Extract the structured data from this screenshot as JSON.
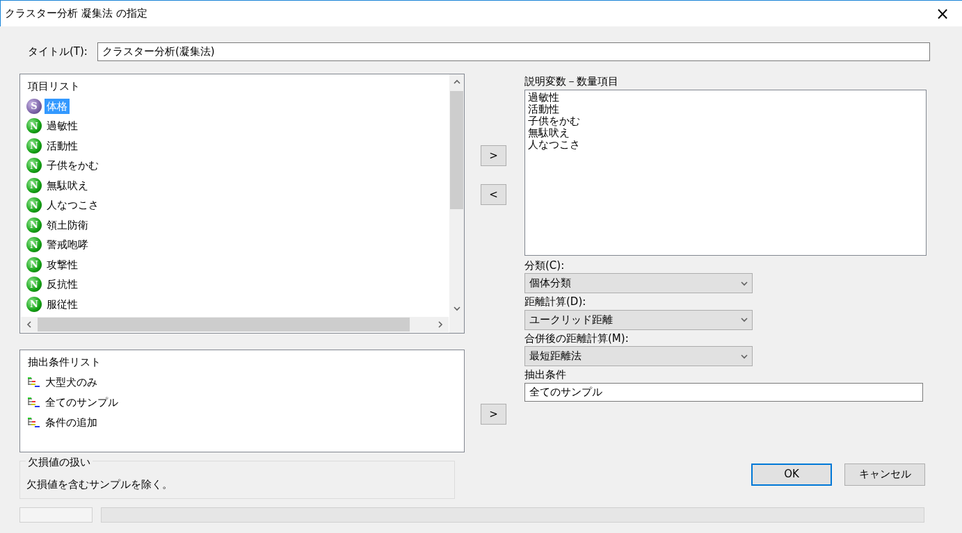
{
  "window": {
    "title": "クラスター分析 凝集法 の指定",
    "close": "×"
  },
  "title_field": {
    "label": "タイトル(T):",
    "value": "クラスター分析(凝集法)"
  },
  "item_list": {
    "header": "項目リスト",
    "items": [
      {
        "label": "体格",
        "icon_letter": "S",
        "kind": "string",
        "selected": true
      },
      {
        "label": "過敏性",
        "icon_letter": "N",
        "kind": "numeric",
        "selected": false
      },
      {
        "label": "活動性",
        "icon_letter": "N",
        "kind": "numeric",
        "selected": false
      },
      {
        "label": "子供をかむ",
        "icon_letter": "N",
        "kind": "numeric",
        "selected": false
      },
      {
        "label": "無駄吠え",
        "icon_letter": "N",
        "kind": "numeric",
        "selected": false
      },
      {
        "label": "人なつこさ",
        "icon_letter": "N",
        "kind": "numeric",
        "selected": false
      },
      {
        "label": "領土防衛",
        "icon_letter": "N",
        "kind": "numeric",
        "selected": false
      },
      {
        "label": "警戒咆哮",
        "icon_letter": "N",
        "kind": "numeric",
        "selected": false
      },
      {
        "label": "攻撃性",
        "icon_letter": "N",
        "kind": "numeric",
        "selected": false
      },
      {
        "label": "反抗性",
        "icon_letter": "N",
        "kind": "numeric",
        "selected": false
      },
      {
        "label": "服従性",
        "icon_letter": "N",
        "kind": "numeric",
        "selected": false
      }
    ]
  },
  "move_buttons": [
    ">",
    "<"
  ],
  "explanatory": {
    "label": "説明変数－数量項目",
    "items": [
      "過敏性",
      "活動性",
      "子供をかむ",
      "無駄吠え",
      "人なつこさ"
    ]
  },
  "combos": [
    {
      "label": "分類(C):",
      "value": "個体分類"
    },
    {
      "label": "距離計算(D):",
      "value": "ユークリッド距離"
    },
    {
      "label": "合併後の距離計算(M):",
      "value": "最短距離法"
    }
  ],
  "condition_list": {
    "header": "抽出条件リスト",
    "items": [
      "大型犬のみ",
      "全てのサンプル",
      "条件の追加"
    ]
  },
  "condition_button": ">",
  "condition_field": {
    "label": "抽出条件",
    "value": "全てのサンプル"
  },
  "missing": {
    "legend": "欠損値の扱い",
    "text": "欠損値を含むサンプルを除く。"
  },
  "buttons": [
    {
      "label": "OK",
      "default": true
    },
    {
      "label": "キャンセル",
      "default": false
    }
  ]
}
